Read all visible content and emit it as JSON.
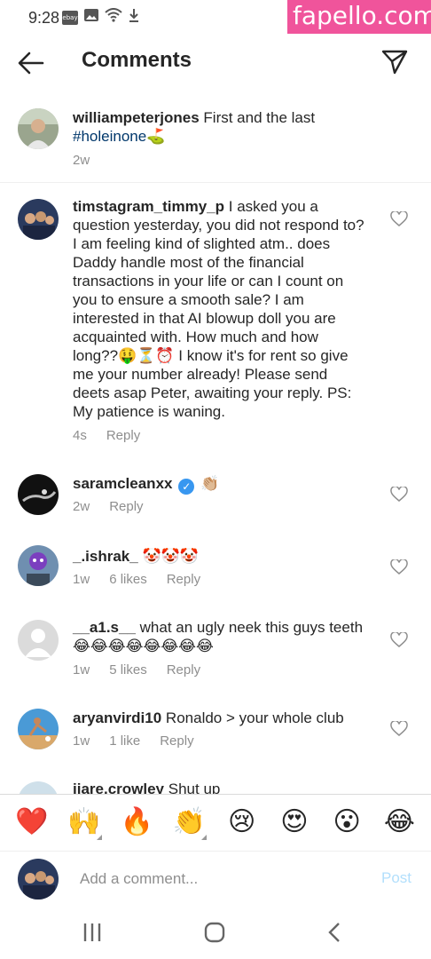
{
  "status_bar": {
    "time": "9:28",
    "icons": [
      "ebay-icon",
      "image-icon",
      "wifi-icon",
      "download-icon"
    ],
    "ebay_label": "ebay"
  },
  "watermark": "fapello.com",
  "header": {
    "title": "Comments",
    "back_icon": "arrow-left-icon",
    "send_icon": "paper-plane-icon"
  },
  "caption": {
    "username": "williampeterjones",
    "text": "First and the last",
    "hashtag": "#holeinone⛳",
    "time": "2w"
  },
  "comments": [
    {
      "username": "timstagram_timmy_p",
      "text": "I asked you a question yesterday, you did not respond to? I am feeling kind of slighted atm.. does Daddy handle most of the financial transactions in your life or can I count on you to ensure a smooth sale? I am interested in that AI blowup doll you are acquainted with. How much and how long??🤑⏳⏰ I know it's for rent so give me your number already! Please send deets asap Peter, awaiting your reply. PS: My patience is waning.",
      "time": "4s",
      "likes": "",
      "reply": "Reply"
    },
    {
      "username": "saramcleanxx",
      "verified": true,
      "text": "👏🏼",
      "time": "2w",
      "likes": "",
      "reply": "Reply"
    },
    {
      "username": "_.ishrak_",
      "text": "🤡🤡🤡",
      "time": "1w",
      "likes": "6 likes",
      "reply": "Reply"
    },
    {
      "username": "__a1.s__",
      "text": "what an ugly neek this guys teeth 😂😂😂😂😂😂😂😂",
      "time": "1w",
      "likes": "5 likes",
      "reply": "Reply"
    },
    {
      "username": "aryanvirdi10",
      "text": "Ronaldo > your whole club",
      "time": "1w",
      "likes": "1 like",
      "reply": "Reply"
    },
    {
      "username": "jiare.crowley",
      "text": "Shut up"
    }
  ],
  "emoji_bar": [
    "❤️",
    "🙌",
    "🔥",
    "👏",
    "😢",
    "😍",
    "😮",
    "😂"
  ],
  "composer": {
    "placeholder": "Add a comment...",
    "post_label": "Post"
  },
  "nav": [
    "recent-apps-icon",
    "home-icon",
    "back-icon"
  ]
}
